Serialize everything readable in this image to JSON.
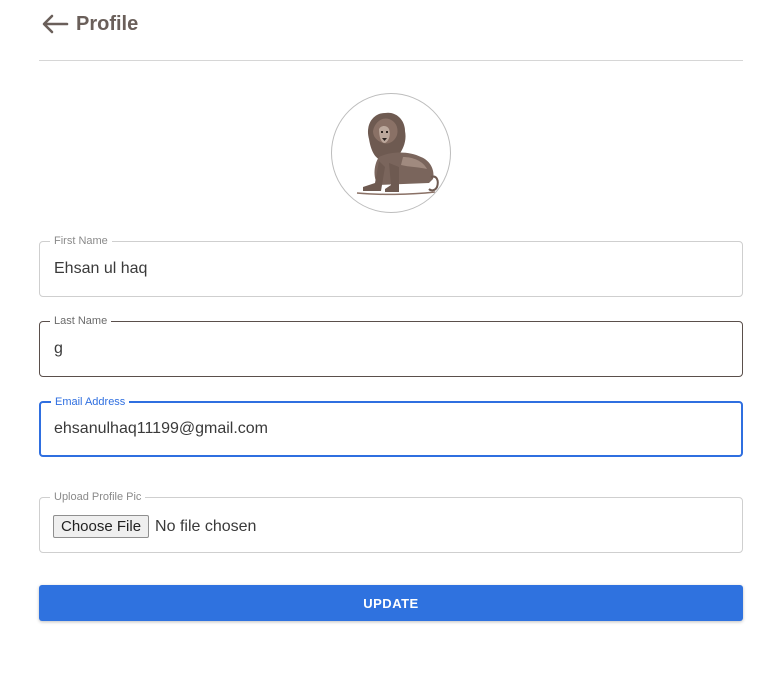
{
  "header": {
    "title": "Profile",
    "back_icon": "arrow-left-icon"
  },
  "avatar": {
    "icon": "lion-image"
  },
  "form": {
    "first_name": {
      "label": "First Name",
      "value": "Ehsan ul haq"
    },
    "last_name": {
      "label": "Last Name",
      "value": "g"
    },
    "email": {
      "label": "Email Address",
      "value": "ehsanulhaq11199@gmail.com"
    },
    "upload": {
      "label": "Upload Profile Pic",
      "button": "Choose File",
      "status": "No file chosen"
    },
    "submit_label": "UPDATE"
  },
  "colors": {
    "accent": "#2f72df",
    "title": "#6a5f5a"
  }
}
